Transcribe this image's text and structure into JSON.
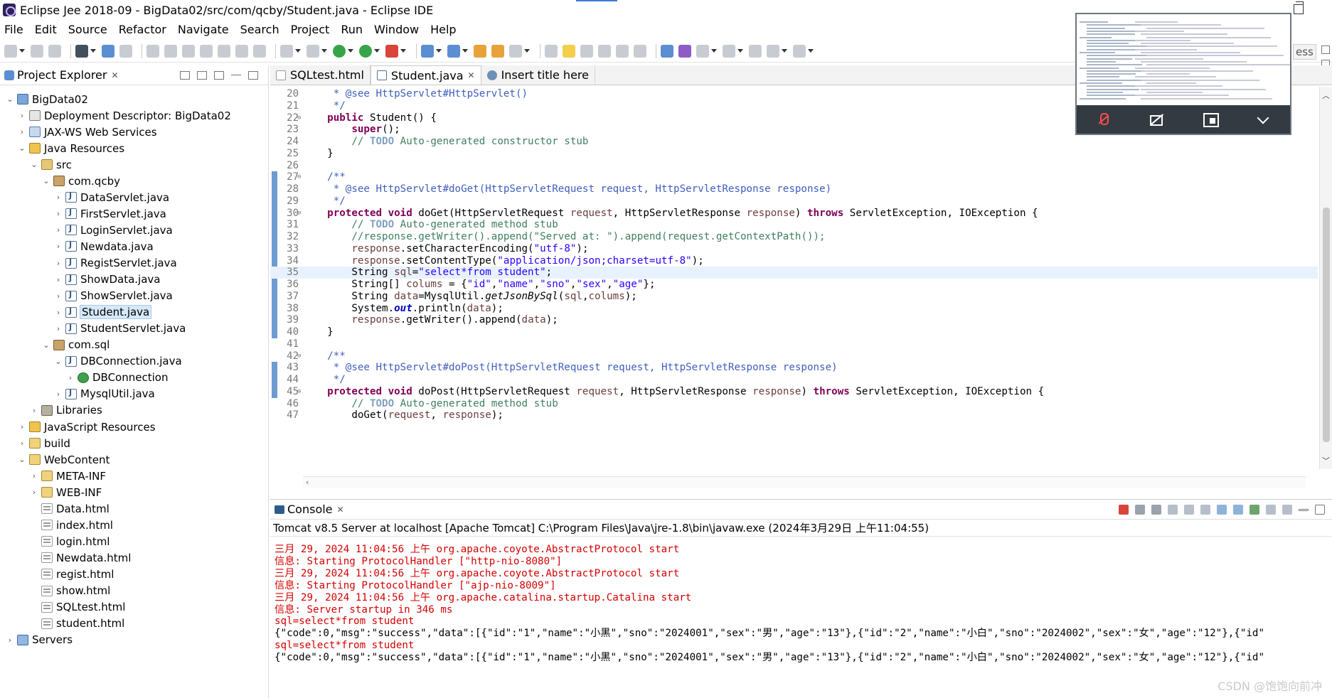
{
  "window": {
    "title": "Eclipse Jee 2018-09 - BigData02/src/com/qcby/Student.java - Eclipse IDE"
  },
  "menu": [
    "File",
    "Edit",
    "Source",
    "Refactor",
    "Navigate",
    "Search",
    "Project",
    "Run",
    "Window",
    "Help"
  ],
  "explorer": {
    "title": "Project Explorer",
    "tree": [
      {
        "label": "BigData02",
        "depth": 0,
        "arrow": "⌄",
        "icon": "project"
      },
      {
        "label": "Deployment Descriptor: BigData02",
        "depth": 1,
        "arrow": "›",
        "icon": "descriptor"
      },
      {
        "label": "JAX-WS Web Services",
        "depth": 1,
        "arrow": "›",
        "icon": "ws"
      },
      {
        "label": "Java Resources",
        "depth": 1,
        "arrow": "⌄",
        "icon": "resources"
      },
      {
        "label": "src",
        "depth": 2,
        "arrow": "⌄",
        "icon": "src"
      },
      {
        "label": "com.qcby",
        "depth": 3,
        "arrow": "⌄",
        "icon": "package"
      },
      {
        "label": "DataServlet.java",
        "depth": 4,
        "arrow": "›",
        "icon": "java"
      },
      {
        "label": "FirstServlet.java",
        "depth": 4,
        "arrow": "›",
        "icon": "java"
      },
      {
        "label": "LoginServlet.java",
        "depth": 4,
        "arrow": "›",
        "icon": "java"
      },
      {
        "label": "Newdata.java",
        "depth": 4,
        "arrow": "›",
        "icon": "java"
      },
      {
        "label": "RegistServlet.java",
        "depth": 4,
        "arrow": "›",
        "icon": "java"
      },
      {
        "label": "ShowData.java",
        "depth": 4,
        "arrow": "›",
        "icon": "java"
      },
      {
        "label": "ShowServlet.java",
        "depth": 4,
        "arrow": "›",
        "icon": "java"
      },
      {
        "label": "Student.java",
        "depth": 4,
        "arrow": "›",
        "icon": "java",
        "selected": true
      },
      {
        "label": "StudentServlet.java",
        "depth": 4,
        "arrow": "›",
        "icon": "java"
      },
      {
        "label": "com.sql",
        "depth": 3,
        "arrow": "⌄",
        "icon": "package"
      },
      {
        "label": "DBConnection.java",
        "depth": 4,
        "arrow": "⌄",
        "icon": "java"
      },
      {
        "label": "DBConnection",
        "depth": 5,
        "arrow": "›",
        "icon": "class"
      },
      {
        "label": "MysqlUtil.java",
        "depth": 4,
        "arrow": "›",
        "icon": "java"
      },
      {
        "label": "Libraries",
        "depth": 2,
        "arrow": "›",
        "icon": "libs"
      },
      {
        "label": "JavaScript Resources",
        "depth": 1,
        "arrow": "›",
        "icon": "resources"
      },
      {
        "label": "build",
        "depth": 1,
        "arrow": "›",
        "icon": "folder"
      },
      {
        "label": "WebContent",
        "depth": 1,
        "arrow": "⌄",
        "icon": "folder"
      },
      {
        "label": "META-INF",
        "depth": 2,
        "arrow": "›",
        "icon": "folder"
      },
      {
        "label": "WEB-INF",
        "depth": 2,
        "arrow": "›",
        "icon": "folder"
      },
      {
        "label": "Data.html",
        "depth": 2,
        "arrow": "",
        "icon": "html"
      },
      {
        "label": "index.html",
        "depth": 2,
        "arrow": "",
        "icon": "html"
      },
      {
        "label": "login.html",
        "depth": 2,
        "arrow": "",
        "icon": "html"
      },
      {
        "label": "Newdata.html",
        "depth": 2,
        "arrow": "",
        "icon": "html"
      },
      {
        "label": "regist.html",
        "depth": 2,
        "arrow": "",
        "icon": "html"
      },
      {
        "label": "show.html",
        "depth": 2,
        "arrow": "",
        "icon": "html"
      },
      {
        "label": "SQLtest.html",
        "depth": 2,
        "arrow": "",
        "icon": "html"
      },
      {
        "label": "student.html",
        "depth": 2,
        "arrow": "",
        "icon": "html"
      },
      {
        "label": "Servers",
        "depth": 0,
        "arrow": "›",
        "icon": "servers"
      }
    ]
  },
  "editor": {
    "tabs": [
      {
        "label": "SQLtest.html",
        "icon": "htmlico",
        "active": false
      },
      {
        "label": "Student.java",
        "icon": "javaico",
        "active": true
      },
      {
        "label": "Insert title here",
        "icon": "globe",
        "active": false
      }
    ],
    "current_line": "35",
    "lines": [
      {
        "n": "20",
        "marker": "",
        "html": "     <span class=\"jd\">* @see HttpServlet#HttpServlet()</span>"
      },
      {
        "n": "21",
        "marker": "",
        "html": "     <span class=\"jd\">*/</span>"
      },
      {
        "n": "22",
        "marker": "⊖",
        "html": "    <span class=\"kw\">public</span> Student() {"
      },
      {
        "n": "23",
        "marker": "",
        "html": "        <span class=\"kw\">super</span>();"
      },
      {
        "n": "24",
        "marker": "",
        "html": "        <span class=\"cm\">// </span><span class=\"todo\">TODO</span><span class=\"cm\"> Auto-generated constructor stub</span>"
      },
      {
        "n": "25",
        "marker": "",
        "html": "    }"
      },
      {
        "n": "26",
        "marker": "",
        "html": ""
      },
      {
        "n": "27",
        "marker": "⊖",
        "html": "    <span class=\"jd\">/**</span>"
      },
      {
        "n": "28",
        "marker": "",
        "html": "     <span class=\"jd\">* @see HttpServlet#doGet(HttpServletRequest request, HttpServletResponse response)</span>"
      },
      {
        "n": "29",
        "marker": "",
        "html": "     <span class=\"jd\">*/</span>"
      },
      {
        "n": "30",
        "marker": "⊖",
        "html": "    <span class=\"kw\">protected void</span> doGet(HttpServletRequest <span class=\"var\">request</span>, HttpServletResponse <span class=\"var\">response</span>) <span class=\"kw\">throws</span> ServletException, IOException {"
      },
      {
        "n": "31",
        "marker": "",
        "html": "        <span class=\"cm\">// </span><span class=\"todo\">TODO</span><span class=\"cm\"> Auto-generated method stub</span>"
      },
      {
        "n": "32",
        "marker": "",
        "html": "        <span class=\"cm\">//response.getWriter().append(\"Served at: \").append(request.getContextPath());</span>"
      },
      {
        "n": "33",
        "marker": "",
        "html": "        <span class=\"var\">response</span>.setCharacterEncoding(<span class=\"st\">\"utf-8\"</span>);"
      },
      {
        "n": "34",
        "marker": "",
        "html": "        <span class=\"var\">response</span>.setContentType(<span class=\"st\">\"application/json;charset=utf-8\"</span>);"
      },
      {
        "n": "35",
        "marker": "",
        "html": "        String <span class=\"var\">sql</span>=<span class=\"st\">\"select*from student\"</span>;"
      },
      {
        "n": "36",
        "marker": "",
        "html": "        String[] <span class=\"var\">colums</span> = {<span class=\"st\">\"id\"</span>,<span class=\"st\">\"name\"</span>,<span class=\"st\">\"sno\"</span>,<span class=\"st\">\"sex\"</span>,<span class=\"st\">\"age\"</span>};"
      },
      {
        "n": "37",
        "marker": "",
        "html": "        String <span class=\"var\">data</span>=MysqlUtil.<span class=\"it\">getJsonBySql</span>(<span class=\"var\">sql</span>,<span class=\"var\">colums</span>);"
      },
      {
        "n": "38",
        "marker": "",
        "html": "        System.<span class=\"fld\">out</span>.println(<span class=\"var\">data</span>);"
      },
      {
        "n": "39",
        "marker": "",
        "html": "        <span class=\"var\">response</span>.getWriter().append(<span class=\"var\">data</span>);"
      },
      {
        "n": "40",
        "marker": "",
        "html": "    }"
      },
      {
        "n": "41",
        "marker": "",
        "html": ""
      },
      {
        "n": "42",
        "marker": "⊖",
        "html": "    <span class=\"jd\">/**</span>"
      },
      {
        "n": "43",
        "marker": "",
        "html": "     <span class=\"jd\">* @see HttpServlet#doPost(HttpServletRequest request, HttpServletResponse response)</span>"
      },
      {
        "n": "44",
        "marker": "",
        "html": "     <span class=\"jd\">*/</span>"
      },
      {
        "n": "45",
        "marker": "⊖",
        "html": "    <span class=\"kw\">protected void</span> doPost(HttpServletRequest <span class=\"var\">request</span>, HttpServletResponse <span class=\"var\">response</span>) <span class=\"kw\">throws</span> ServletException, IOException {"
      },
      {
        "n": "46",
        "marker": "",
        "html": "        <span class=\"cm\">// </span><span class=\"todo\">TODO</span><span class=\"cm\"> Auto-generated method stub</span>"
      },
      {
        "n": "47",
        "marker": "",
        "html": "        doGet(<span class=\"var\">request</span>, <span class=\"var\">response</span>);"
      }
    ]
  },
  "console": {
    "title": "Console",
    "description": "Tomcat v8.5 Server at localhost [Apache Tomcat] C:\\Program Files\\Java\\jre-1.8\\bin\\javaw.exe (2024年3月29日 上午11:04:55)",
    "lines": [
      {
        "text": "三月 29, 2024 11:04:56 上午 org.apache.coyote.AbstractProtocol start",
        "color": "red"
      },
      {
        "text": "信息: Starting ProtocolHandler [\"http-nio-8080\"]",
        "color": "red"
      },
      {
        "text": "三月 29, 2024 11:04:56 上午 org.apache.coyote.AbstractProtocol start",
        "color": "red"
      },
      {
        "text": "信息: Starting ProtocolHandler [\"ajp-nio-8009\"]",
        "color": "red"
      },
      {
        "text": "三月 29, 2024 11:04:56 上午 org.apache.catalina.startup.Catalina start",
        "color": "red"
      },
      {
        "text": "信息: Server startup in 346 ms",
        "color": "red"
      },
      {
        "text": "sql=select*from student",
        "color": "red"
      },
      {
        "text": "{\"code\":0,\"msg\":\"success\",\"data\":[{\"id\":\"1\",\"name\":\"小黑\",\"sno\":\"2024001\",\"sex\":\"男\",\"age\":\"13\"},{\"id\":\"2\",\"name\":\"小白\",\"sno\":\"2024002\",\"sex\":\"女\",\"age\":\"12\"},{\"id\"",
        "color": "black"
      },
      {
        "text": "sql=select*from student",
        "color": "red"
      },
      {
        "text": "{\"code\":0,\"msg\":\"success\",\"data\":[{\"id\":\"1\",\"name\":\"小黑\",\"sno\":\"2024001\",\"sex\":\"男\",\"age\":\"13\"},{\"id\":\"2\",\"name\":\"小白\",\"sno\":\"2024002\",\"sex\":\"女\",\"age\":\"12\"},{\"id\"",
        "color": "black"
      }
    ]
  },
  "side_tab": "ess",
  "watermark": "CSDN @饱饱向前冲",
  "colors": {
    "keyword": "#7f0055",
    "comment": "#3f7f5f",
    "javadoc": "#3f5fbf",
    "string": "#2a00ff",
    "console_error": "#d40000",
    "selection": "#d6e8fa"
  }
}
